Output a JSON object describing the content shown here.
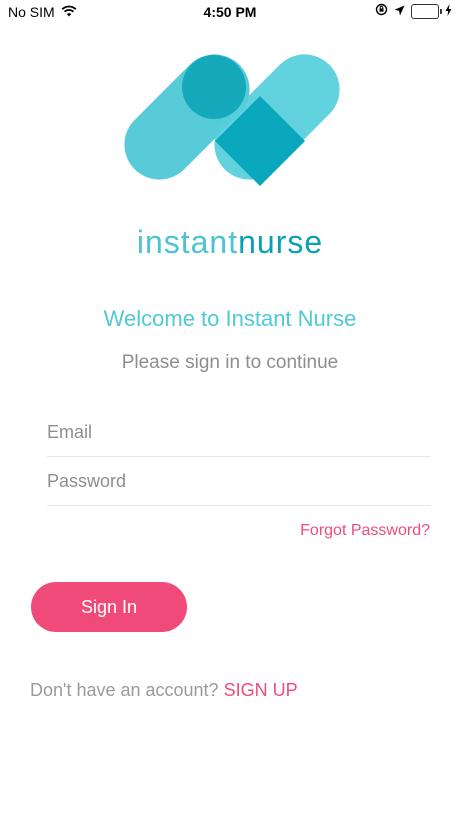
{
  "status_bar": {
    "carrier": "No SIM",
    "time": "4:50 PM"
  },
  "brand": {
    "part1": "instant",
    "part2": "nurse"
  },
  "welcome_title": "Welcome to Instant Nurse",
  "subtitle": "Please sign in to continue",
  "form": {
    "email_placeholder": "Email",
    "email_value": "",
    "password_placeholder": "Password",
    "password_value": "",
    "forgot_label": "Forgot Password?",
    "signin_label": "Sign In"
  },
  "signup": {
    "prompt": "Don't have an account?",
    "link_label": "SIGN UP"
  },
  "colors": {
    "teal_light": "#4ec9d6",
    "teal_dark": "#0aa1b6",
    "accent_pink": "#f04a79",
    "muted_gray": "#8e8e8e"
  }
}
